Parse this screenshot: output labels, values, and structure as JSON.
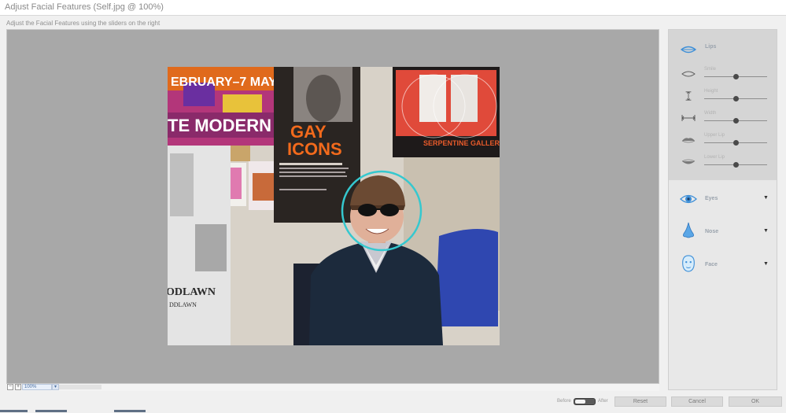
{
  "window": {
    "title": "Adjust Facial Features (Self.jpg @ 100%)",
    "instruction": "Adjust the Facial Features using the sliders on the right"
  },
  "zoom": {
    "minus": "−",
    "plus": "+",
    "value": "100%"
  },
  "panel": {
    "lips": {
      "label": "Lips",
      "sliders": [
        {
          "label": "Smile",
          "value": 0.5
        },
        {
          "label": "Height",
          "value": 0.5
        },
        {
          "label": "Width",
          "value": 0.5
        },
        {
          "label": "Upper Lip",
          "value": 0.5
        },
        {
          "label": "Lower Lip",
          "value": 0.5
        }
      ]
    },
    "features": [
      {
        "label": "Eyes",
        "chevron": "▼",
        "icon": "eye-icon"
      },
      {
        "label": "Nose",
        "chevron": "▼",
        "icon": "nose-icon"
      },
      {
        "label": "Face",
        "chevron": "▼",
        "icon": "face-icon"
      }
    ]
  },
  "footer": {
    "before": "Before",
    "after": "After",
    "reset": "Reset",
    "cancel": "Cancel",
    "ok": "OK"
  },
  "colors": {
    "face_marker": "#35c8cf",
    "icon_blue": "#3d8fd8"
  }
}
